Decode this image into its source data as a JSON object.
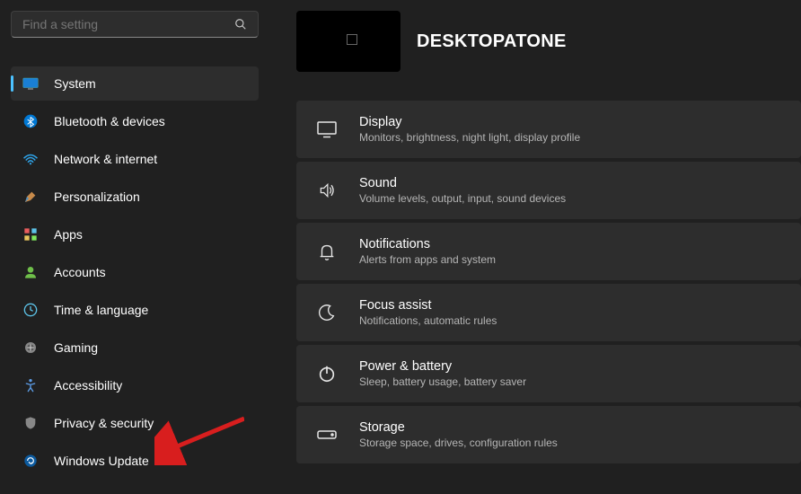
{
  "search": {
    "placeholder": "Find a setting"
  },
  "nav": {
    "items": [
      {
        "label": "System"
      },
      {
        "label": "Bluetooth & devices"
      },
      {
        "label": "Network & internet"
      },
      {
        "label": "Personalization"
      },
      {
        "label": "Apps"
      },
      {
        "label": "Accounts"
      },
      {
        "label": "Time & language"
      },
      {
        "label": "Gaming"
      },
      {
        "label": "Accessibility"
      },
      {
        "label": "Privacy & security"
      },
      {
        "label": "Windows Update"
      }
    ]
  },
  "header": {
    "title": "DESKTOPATONE"
  },
  "cards": [
    {
      "title": "Display",
      "sub": "Monitors, brightness, night light, display profile"
    },
    {
      "title": "Sound",
      "sub": "Volume levels, output, input, sound devices"
    },
    {
      "title": "Notifications",
      "sub": "Alerts from apps and system"
    },
    {
      "title": "Focus assist",
      "sub": "Notifications, automatic rules"
    },
    {
      "title": "Power & battery",
      "sub": "Sleep, battery usage, battery saver"
    },
    {
      "title": "Storage",
      "sub": "Storage space, drives, configuration rules"
    }
  ]
}
